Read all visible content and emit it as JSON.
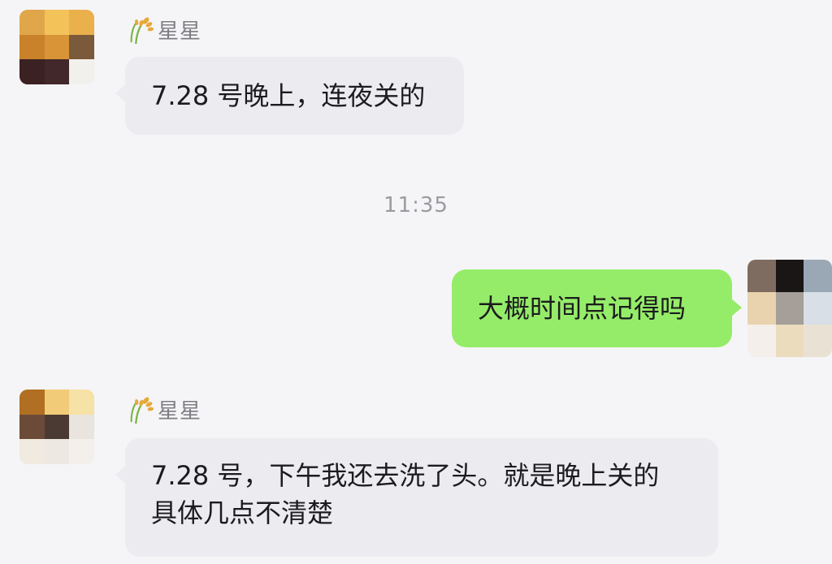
{
  "messages": [
    {
      "sender": "星星",
      "sender_icon": "wheat-icon",
      "direction": "incoming",
      "text": "7.28 号晚上，连夜关的"
    },
    {
      "direction": "outgoing",
      "text": "大概时间点记得吗"
    },
    {
      "sender": "星星",
      "sender_icon": "wheat-icon",
      "direction": "incoming",
      "text_line1": "7.28 号，下午我还去洗了头。就是晚上关的",
      "text_line2": "具体几点不清楚"
    }
  ],
  "timestamp": "11:35",
  "colors": {
    "background": "#f5f5f7",
    "incoming_bubble": "#ebebf0",
    "outgoing_bubble": "#95ec69",
    "sender_name": "#7d7d83",
    "timestamp": "#9a9aa0"
  },
  "avatars": {
    "contact_1": [
      "#e0a64a",
      "#f3c35a",
      "#e9b04c",
      "#c9812a",
      "#d89437",
      "#7a5a3a",
      "#3b2122",
      "#42282a",
      "#f2f0ec"
    ],
    "self": [
      "#7e6c60",
      "#1a1616",
      "#9aa8b6",
      "#e8d3ae",
      "#a59e99",
      "#d8dfe6",
      "#f4efea",
      "#ecdcbe",
      "#e9e2d4"
    ],
    "contact_2": [
      "#b06f22",
      "#f2cb78",
      "#f6e1a6",
      "#6b4a38",
      "#4a3a33",
      "#e9e4dd",
      "#f1eae0",
      "#ede8e2",
      "#f3f0ec"
    ]
  }
}
